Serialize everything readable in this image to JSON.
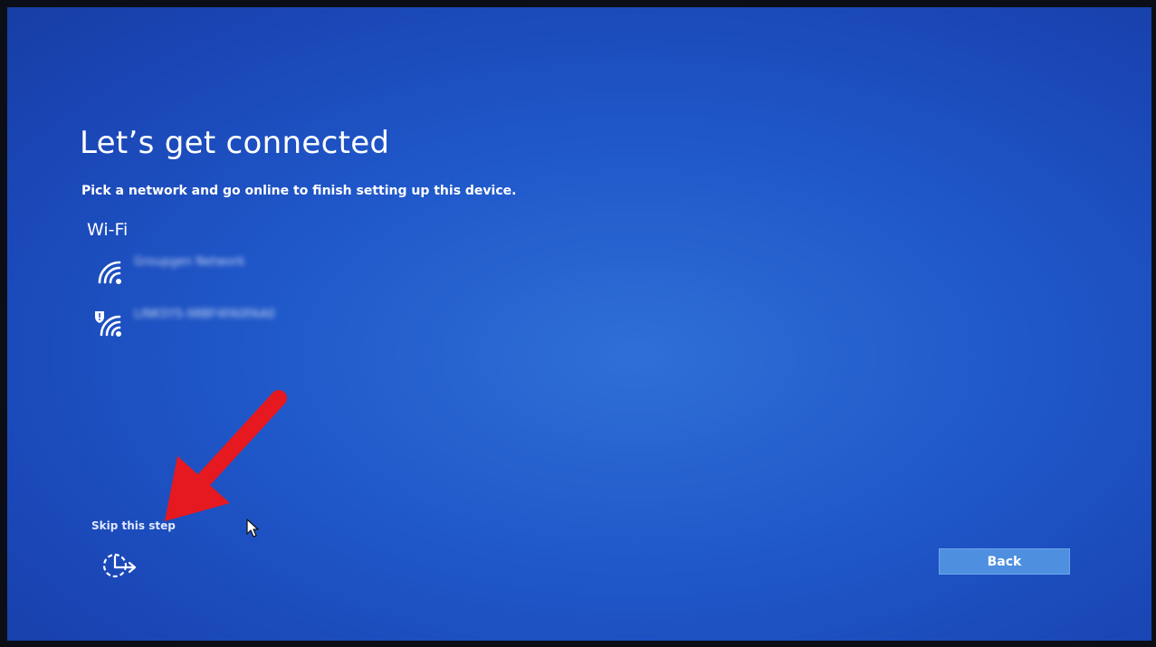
{
  "page": {
    "title": "Let’s get connected",
    "subtitle": "Pick a network and go online to finish setting up this device.",
    "section_label": "Wi-Fi"
  },
  "networks": [
    {
      "name": "Groupgen Network",
      "icon": "wifi-icon",
      "secured": false
    },
    {
      "name": "LINKSYS-98BF4FA0FAA0",
      "icon": "wifi-warning-icon",
      "secured": true
    }
  ],
  "footer": {
    "skip_label": "Skip this step",
    "ease_icon": "ease-of-access-icon",
    "back_label": "Back"
  },
  "colors": {
    "background": "#1f57c9",
    "button": "#4e8fe0",
    "annotation_arrow": "#e5191f"
  }
}
